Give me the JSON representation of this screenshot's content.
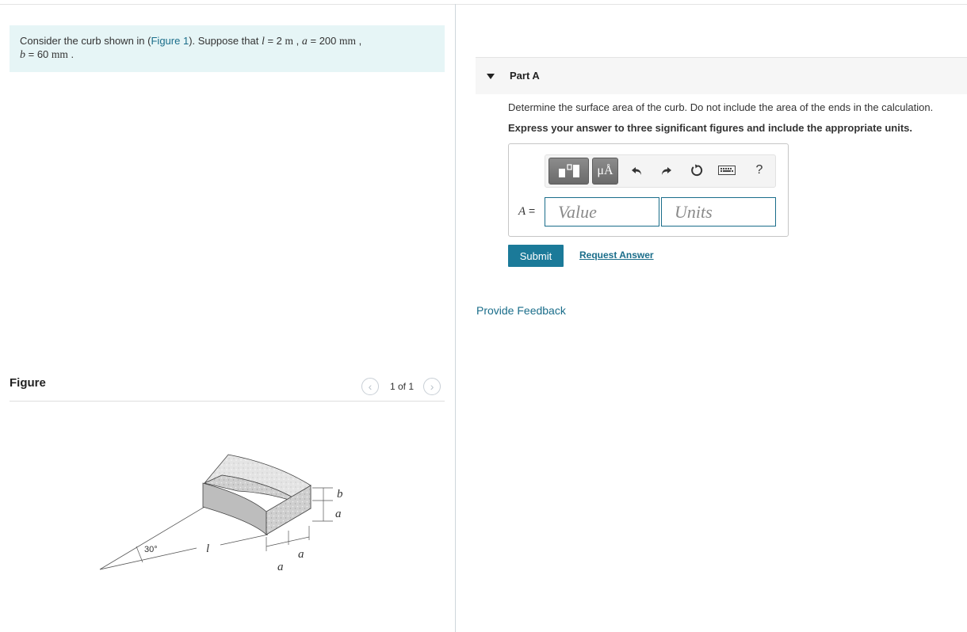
{
  "problem": {
    "text_1": "Consider the curb shown in (",
    "figure_link": "Figure 1",
    "text_2": "). Suppose that ",
    "l_var": "l",
    "l_value": " = 2 ",
    "l_unit": "m",
    "sep_1": " , ",
    "a_var": "a",
    "a_value": " = 200 ",
    "a_unit": "mm",
    "sep_2": " ,",
    "b_var": "b",
    "b_value": " = 60 ",
    "b_unit": "mm",
    "end": " ."
  },
  "figure": {
    "title": "Figure",
    "prev_glyph": "‹",
    "next_glyph": "›",
    "counter": "1 of 1",
    "labels": {
      "b": "b",
      "a_right": "a",
      "a_bottom_1": "a",
      "a_bottom_2": "a",
      "l": "l",
      "angle": "30°"
    }
  },
  "part_a": {
    "title": "Part A",
    "question": "Determine the surface area of the curb. Do not include the area of the ends in the calculation.",
    "instruction": "Express your answer to three significant figures and include the appropriate units.",
    "toolbar": {
      "units_label": "μÅ",
      "help_label": "?",
      "icons": [
        "templates-icon",
        "units-icon",
        "undo-icon",
        "redo-icon",
        "reset-icon",
        "keyboard-icon",
        "help-icon"
      ]
    },
    "answer_var": "A",
    "equals": " =",
    "value_placeholder": "Value",
    "units_placeholder": "Units",
    "submit_label": "Submit",
    "request_label": "Request Answer"
  },
  "feedback_label": "Provide Feedback",
  "colors": {
    "problem_bg": "#e6f5f6",
    "link": "#1a6d8a",
    "submit_bg": "#1b7a99",
    "part_header_bg": "#f6f6f6"
  }
}
